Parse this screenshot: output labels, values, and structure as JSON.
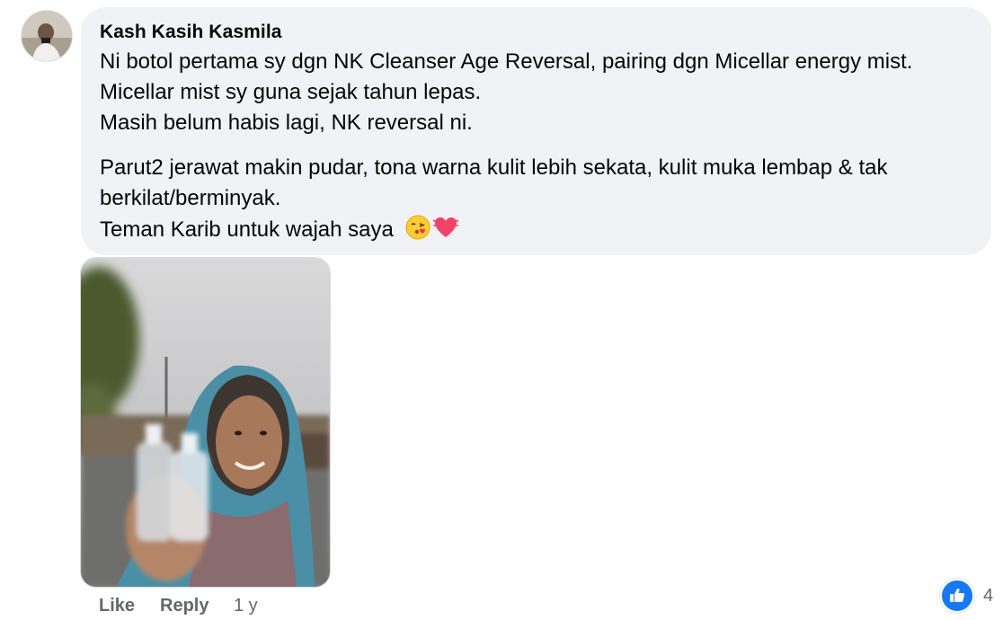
{
  "comment": {
    "author": "Kash Kasih Kasmila",
    "lines": [
      "Ni botol pertama sy dgn NK Cleanser Age Reversal, pairing dgn Micellar energy mist.",
      "Micellar mist sy guna sejak tahun lepas.",
      "Masih belum habis lagi, NK reversal ni.",
      "Parut2 jerawat makin pudar, tona warna kulit lebih sekata, kulit muka lembap & tak",
      "berkilat/berminyak.",
      "Teman Karib untuk wajah saya"
    ],
    "emojis": [
      "kissing-face-icon",
      "beating-heart-icon"
    ]
  },
  "actions": {
    "like_label": "Like",
    "reply_label": "Reply",
    "timestamp": "1 y"
  },
  "reactions": {
    "icon": "thumbs-up-icon",
    "count": "4",
    "color": "#1877f2"
  },
  "colors": {
    "bubble": "#f0f2f5",
    "secondary_text": "#65676b"
  }
}
